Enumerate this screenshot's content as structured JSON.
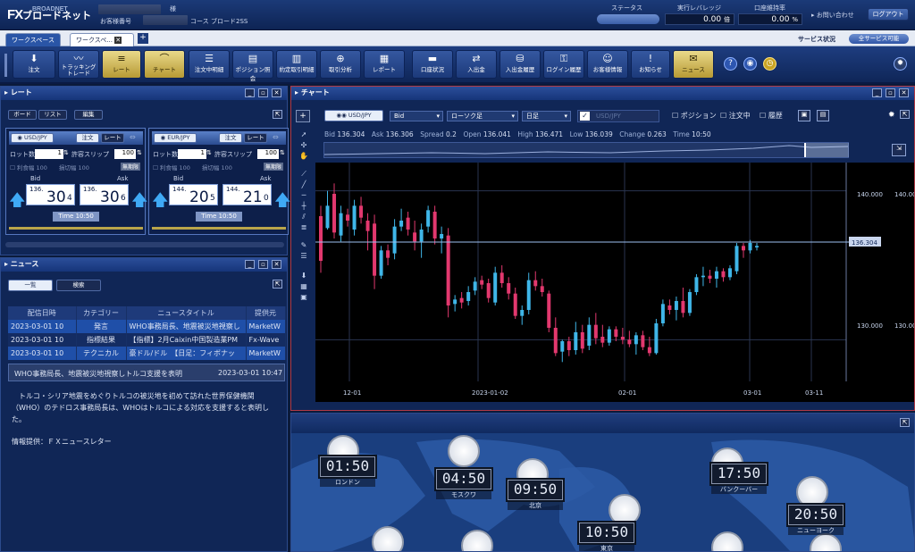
{
  "brand": {
    "logo": "FX",
    "logo_sub": "BROADNET",
    "logo_kana": "ブロードネット"
  },
  "header": {
    "honorific": "様",
    "customer_label": "お客様番号",
    "course_label": "コース",
    "course_value": "ブロード2SS",
    "status_label": "ステータス",
    "leverage_label": "実行レバレッジ",
    "leverage_value": "0.00",
    "leverage_unit": "倍",
    "margin_label": "口座維持率",
    "margin_value": "0.00",
    "margin_unit": "%",
    "contact": "お問い合わせ",
    "logout": "ログアウト"
  },
  "tabs": {
    "items": [
      "ワークスペース",
      "ワークスペ..."
    ],
    "add": "+",
    "service_label": "サービス状況",
    "service_value": "全サービス可能"
  },
  "toolbar": {
    "items": [
      "注文",
      "トラッキングトレード",
      "レート",
      "チャート",
      "注文中明細",
      "ポジション照会",
      "約定取引明細",
      "取引分析",
      "レポート",
      "口座状況",
      "入出金",
      "入出金履歴",
      "ログイン履歴",
      "お客様情報",
      "お知らせ",
      "ニュース"
    ]
  },
  "rate_panel": {
    "title": "レート",
    "tabs": [
      "ボード",
      "リスト",
      "編集"
    ],
    "cards": [
      {
        "pair": "USD/JPY",
        "order": "注文",
        "rate": "レート",
        "lot_label": "ロット数",
        "lot": "1",
        "slip_label": "許容スリップ",
        "slip": "100",
        "profit_label": "利食幅",
        "profit": "100",
        "loss_label": "損切幅",
        "loss": "100",
        "unlimited": "無期限",
        "bid_label": "Bid",
        "ask_label": "Ask",
        "bid_pre": "136.",
        "bid_big": "30",
        "bid_small": "4",
        "ask_pre": "136.",
        "ask_big": "30",
        "ask_small": "6",
        "time_label": "Time",
        "time": "10:50"
      },
      {
        "pair": "EUR/JPY",
        "order": "注文",
        "rate": "レート",
        "lot_label": "ロット数",
        "lot": "1",
        "slip_label": "許容スリップ",
        "slip": "100",
        "profit_label": "利食幅",
        "profit": "100",
        "loss_label": "損切幅",
        "loss": "100",
        "unlimited": "無期限",
        "bid_label": "Bid",
        "ask_label": "Ask",
        "bid_pre": "144.",
        "bid_big": "20",
        "bid_small": "5",
        "ask_pre": "144.",
        "ask_big": "21",
        "ask_small": "0",
        "time_label": "Time",
        "time": "10:50"
      }
    ]
  },
  "news_panel": {
    "title": "ニュース",
    "tabs": [
      "一覧",
      "検索"
    ],
    "columns": [
      "配信日時",
      "カテゴリー",
      "ニュースタイトル",
      "提供元"
    ],
    "rows": [
      [
        "2023-03-01 10",
        "発言",
        "WHO事務局長、地震被災地視察し",
        "MarketW"
      ],
      [
        "2023-03-01 10",
        "指標結果",
        "【指標】2月Caixin中国製造業PM",
        "Fx-Wave"
      ],
      [
        "2023-03-01 10",
        "テクニカル",
        "豪ドル/ドル　【日足：フィボナッ",
        "MarketW"
      ]
    ],
    "detail_title": "WHO事務局長、地震被災地視察しトルコ支援を表明",
    "detail_time": "2023-03-01 10:47",
    "body": "　トルコ・シリア地震をめぐりトルコの被災地を初めて訪れた世界保健機関（WHO）のテドロス事務局長は、WHOはトルコによる対応を支援すると表明した。",
    "source": "情報提供：ＦＸニュースレター"
  },
  "chart_panel": {
    "title": "チャート",
    "pair": "USD/JPY",
    "price_type": "Bid",
    "candle": "ローソク足",
    "period": "日足",
    "compare_pair": "USD/JPY",
    "position": "ポジション",
    "ordering": "注文中",
    "history": "履歴",
    "info": {
      "bid_l": "Bid",
      "bid": "136.304",
      "ask_l": "Ask",
      "ask": "136.306",
      "spread_l": "Spread",
      "spread": "0.2",
      "open_l": "Open",
      "open": "136.041",
      "high_l": "High",
      "high": "136.471",
      "low_l": "Low",
      "low": "136.039",
      "change_l": "Change",
      "change": "0.263",
      "time_l": "Time",
      "time": "10:50"
    }
  },
  "chart_data": {
    "type": "candlestick",
    "y_ticks": [
      "140.000",
      "130.000"
    ],
    "x_ticks": [
      "12-01",
      "2023-01-02",
      "02-01",
      "03-01",
      "03-11"
    ],
    "current": "136.304",
    "ylim": [
      127.2,
      141.9
    ],
    "candles": [
      {
        "o": 138.3,
        "h": 139.0,
        "l": 134.5,
        "c": 135.3
      },
      {
        "o": 137.5,
        "h": 140.0,
        "l": 137.4,
        "c": 139.0
      },
      {
        "o": 139.8,
        "h": 140.5,
        "l": 136.8,
        "c": 137.2
      },
      {
        "o": 137.0,
        "h": 139.0,
        "l": 136.6,
        "c": 138.5
      },
      {
        "o": 138.4,
        "h": 138.8,
        "l": 137.6,
        "c": 138.0
      },
      {
        "o": 137.4,
        "h": 139.4,
        "l": 137.0,
        "c": 139.0
      },
      {
        "o": 139.0,
        "h": 139.6,
        "l": 137.8,
        "c": 138.2
      },
      {
        "o": 138.0,
        "h": 138.5,
        "l": 136.0,
        "c": 137.3
      },
      {
        "o": 137.8,
        "h": 138.4,
        "l": 133.4,
        "c": 134.3
      },
      {
        "o": 134.3,
        "h": 136.3,
        "l": 134.1,
        "c": 136.0
      },
      {
        "o": 136.0,
        "h": 136.4,
        "l": 135.0,
        "c": 135.5
      },
      {
        "o": 135.8,
        "h": 138.1,
        "l": 135.4,
        "c": 137.6
      },
      {
        "o": 137.6,
        "h": 138.8,
        "l": 137.3,
        "c": 138.0
      },
      {
        "o": 138.2,
        "h": 138.6,
        "l": 137.0,
        "c": 137.4
      },
      {
        "o": 137.2,
        "h": 138.0,
        "l": 136.0,
        "c": 136.6
      },
      {
        "o": 136.6,
        "h": 137.8,
        "l": 135.5,
        "c": 137.4
      },
      {
        "o": 137.6,
        "h": 139.0,
        "l": 137.2,
        "c": 138.7
      },
      {
        "o": 138.6,
        "h": 139.0,
        "l": 136.4,
        "c": 136.8
      },
      {
        "o": 136.8,
        "h": 137.6,
        "l": 135.8,
        "c": 137.1
      },
      {
        "o": 137.0,
        "h": 137.5,
        "l": 131.5,
        "c": 132.3
      },
      {
        "o": 132.4,
        "h": 133.0,
        "l": 131.9,
        "c": 132.7
      },
      {
        "o": 132.8,
        "h": 133.2,
        "l": 132.1,
        "c": 132.5
      },
      {
        "o": 132.6,
        "h": 133.6,
        "l": 132.3,
        "c": 133.2
      },
      {
        "o": 133.3,
        "h": 134.2,
        "l": 133.0,
        "c": 133.9
      },
      {
        "o": 134.0,
        "h": 134.3,
        "l": 133.4,
        "c": 133.7
      },
      {
        "o": 133.8,
        "h": 134.1,
        "l": 132.5,
        "c": 132.8
      },
      {
        "o": 132.5,
        "h": 134.9,
        "l": 132.3,
        "c": 134.5
      },
      {
        "o": 134.5,
        "h": 135.0,
        "l": 133.5,
        "c": 133.8
      },
      {
        "o": 133.8,
        "h": 134.2,
        "l": 132.7,
        "c": 133.1
      },
      {
        "o": 133.1,
        "h": 133.5,
        "l": 131.4,
        "c": 131.6
      },
      {
        "o": 131.6,
        "h": 132.3,
        "l": 131.0,
        "c": 132.0
      },
      {
        "o": 132.0,
        "h": 134.5,
        "l": 131.7,
        "c": 134.0
      },
      {
        "o": 134.0,
        "h": 134.6,
        "l": 133.3,
        "c": 133.6
      },
      {
        "o": 133.6,
        "h": 134.1,
        "l": 132.9,
        "c": 133.2
      },
      {
        "o": 133.1,
        "h": 133.3,
        "l": 130.5,
        "c": 130.8
      },
      {
        "o": 130.8,
        "h": 131.5,
        "l": 128.9,
        "c": 129.1
      },
      {
        "o": 129.2,
        "h": 130.0,
        "l": 128.5,
        "c": 129.9
      },
      {
        "o": 129.9,
        "h": 130.2,
        "l": 128.9,
        "c": 129.3
      },
      {
        "o": 129.3,
        "h": 131.2,
        "l": 129.0,
        "c": 130.5
      },
      {
        "o": 130.5,
        "h": 131.0,
        "l": 129.1,
        "c": 129.4
      },
      {
        "o": 129.6,
        "h": 131.5,
        "l": 129.3,
        "c": 131.0
      },
      {
        "o": 131.0,
        "h": 131.8,
        "l": 129.7,
        "c": 130.1
      },
      {
        "o": 130.2,
        "h": 131.0,
        "l": 129.5,
        "c": 129.8
      },
      {
        "o": 129.8,
        "h": 130.9,
        "l": 129.6,
        "c": 130.7
      },
      {
        "o": 130.7,
        "h": 130.9,
        "l": 129.9,
        "c": 130.2
      },
      {
        "o": 130.2,
        "h": 130.8,
        "l": 129.7,
        "c": 130.0
      },
      {
        "o": 130.0,
        "h": 130.6,
        "l": 129.5,
        "c": 129.7
      },
      {
        "o": 129.7,
        "h": 130.5,
        "l": 129.0,
        "c": 130.3
      },
      {
        "o": 130.3,
        "h": 130.6,
        "l": 129.3,
        "c": 129.5
      },
      {
        "o": 129.5,
        "h": 130.2,
        "l": 128.9,
        "c": 129.1
      },
      {
        "o": 129.1,
        "h": 131.4,
        "l": 129.0,
        "c": 131.1
      },
      {
        "o": 131.1,
        "h": 132.7,
        "l": 130.9,
        "c": 132.4
      },
      {
        "o": 132.3,
        "h": 132.7,
        "l": 131.7,
        "c": 132.0
      },
      {
        "o": 132.0,
        "h": 132.9,
        "l": 131.3,
        "c": 132.6
      },
      {
        "o": 132.6,
        "h": 133.5,
        "l": 131.5,
        "c": 131.8
      },
      {
        "o": 131.8,
        "h": 133.4,
        "l": 131.6,
        "c": 133.2
      },
      {
        "o": 133.2,
        "h": 134.4,
        "l": 133.0,
        "c": 134.2
      },
      {
        "o": 134.2,
        "h": 134.9,
        "l": 133.6,
        "c": 134.3
      },
      {
        "o": 134.3,
        "h": 134.7,
        "l": 133.8,
        "c": 134.1
      },
      {
        "o": 134.1,
        "h": 134.9,
        "l": 133.5,
        "c": 134.6
      },
      {
        "o": 134.6,
        "h": 134.8,
        "l": 133.9,
        "c": 134.2
      },
      {
        "o": 134.2,
        "h": 135.0,
        "l": 134.0,
        "c": 134.8
      },
      {
        "o": 134.6,
        "h": 136.5,
        "l": 134.4,
        "c": 136.3
      },
      {
        "o": 136.3,
        "h": 136.5,
        "l": 135.5,
        "c": 136.0
      },
      {
        "o": 136.0,
        "h": 136.7,
        "l": 135.8,
        "c": 136.5
      },
      {
        "o": 136.2,
        "h": 136.5,
        "l": 136.0,
        "c": 136.3
      }
    ]
  },
  "bottom_panel": {
    "clocks": [
      {
        "city": "ロンドン",
        "time": "01:50"
      },
      {
        "city": "モスクワ",
        "time": "04:50"
      },
      {
        "city": "北京",
        "time": "09:50"
      },
      {
        "city": "東京",
        "time": "10:50"
      },
      {
        "city": "バンクーバー",
        "time": "17:50"
      },
      {
        "city": "ニューヨーク",
        "time": "20:50"
      }
    ]
  },
  "colors": {
    "bull": "#3fb6e8",
    "bear": "#e2386e",
    "accent": "#f1d36a"
  }
}
